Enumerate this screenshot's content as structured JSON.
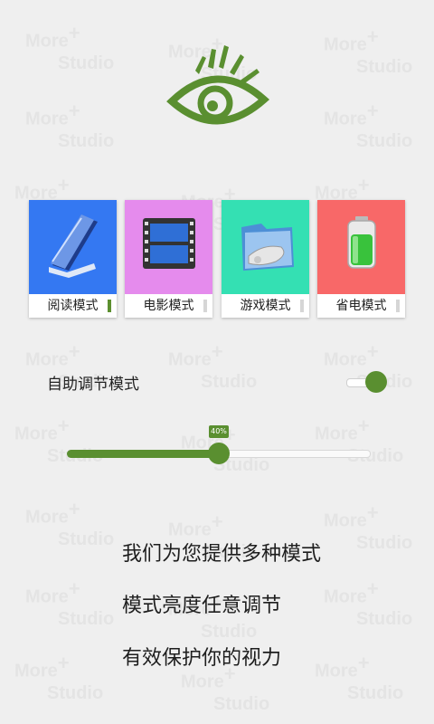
{
  "watermark": {
    "line1": "More",
    "plus": "+",
    "line2": "Studio"
  },
  "logo": {
    "icon": "eye-logo-icon",
    "color": "#5a8f30"
  },
  "modes": [
    {
      "label": "阅读模式",
      "icon": "book-icon",
      "bg": "#3478f2",
      "active": true
    },
    {
      "label": "电影模式",
      "icon": "film-icon",
      "bg": "#e58bed",
      "active": false
    },
    {
      "label": "游戏模式",
      "icon": "game-folder-icon",
      "bg": "#34e0b3",
      "active": false
    },
    {
      "label": "省电模式",
      "icon": "battery-icon",
      "bg": "#f86868",
      "active": false
    }
  ],
  "auto_mode": {
    "label": "自助调节模式",
    "enabled": true
  },
  "brightness": {
    "value": 0.4,
    "label": "40%"
  },
  "promo": {
    "line1": "我们为您提供多种模式",
    "line2": "模式亮度任意调节",
    "line3": "有效保护你的视力"
  },
  "colors": {
    "accent": "#5a8f30",
    "background": "#efefef"
  }
}
